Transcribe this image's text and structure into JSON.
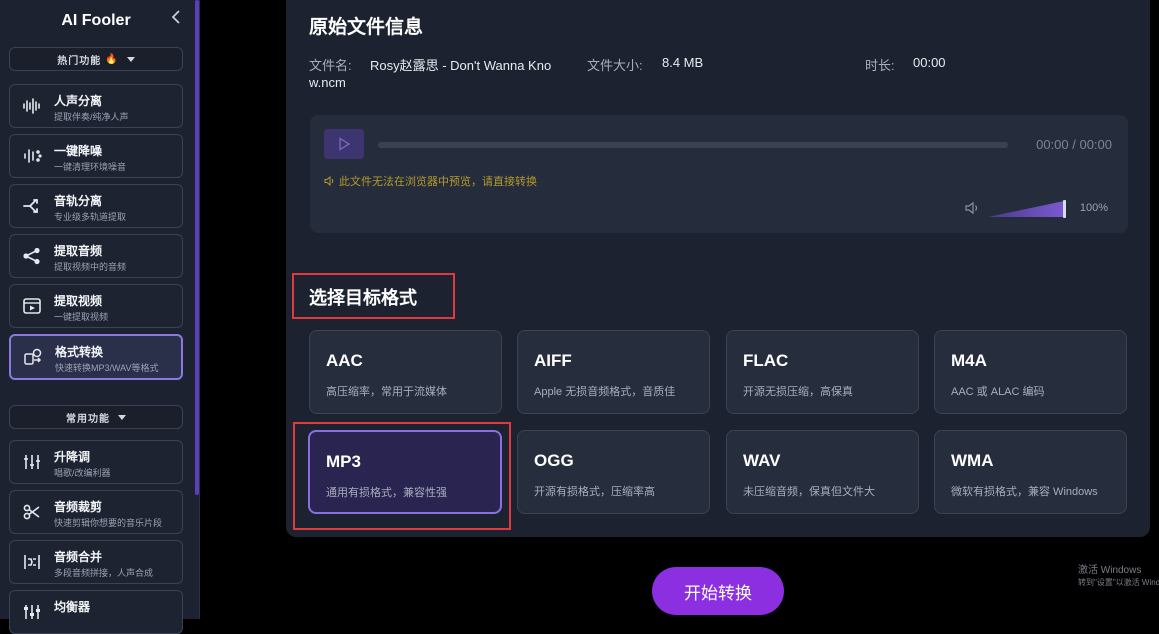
{
  "sidebar": {
    "brand": "AI Fooler",
    "hot_section": {
      "label": "热门功能",
      "icon": "fire-emoji"
    },
    "common_section": {
      "label": "常用功能"
    },
    "hot_items": [
      {
        "title": "人声分离",
        "sub": "提取伴奏/纯净人声",
        "icon": "waveform-icon"
      },
      {
        "title": "一键降噪",
        "sub": "一键清理环境噪音",
        "icon": "noise-reduce-icon"
      },
      {
        "title": "音轨分离",
        "sub": "专业级多轨道提取",
        "icon": "split-icon"
      },
      {
        "title": "提取音频",
        "sub": "提取视频中的音频",
        "icon": "share-icon"
      },
      {
        "title": "提取视频",
        "sub": "一键提取视频",
        "icon": "video-icon"
      },
      {
        "title": "格式转换",
        "sub": "快速转换MP3/WAV等格式",
        "icon": "convert-icon"
      }
    ],
    "common_items": [
      {
        "title": "升降调",
        "sub": "唱歌/改编利器",
        "icon": "pitch-icon"
      },
      {
        "title": "音频裁剪",
        "sub": "快速剪辑你想要的音乐片段",
        "icon": "scissors-icon"
      },
      {
        "title": "音频合并",
        "sub": "多段音频拼接，人声合成",
        "icon": "merge-icon"
      },
      {
        "title": "均衡器",
        "sub": "",
        "icon": "equalizer-icon"
      }
    ]
  },
  "file_info": {
    "heading": "原始文件信息",
    "name_label": "文件名:",
    "name_value_line1": "Rosy赵露思 - Don't Wanna Kno",
    "name_value_line2": "w.ncm",
    "size_label": "文件大小:",
    "size_value": "8.4 MB",
    "duration_label": "时长:",
    "duration_value": "00:00"
  },
  "player": {
    "time": "00:00 / 00:00",
    "warning": "此文件无法在浏览器中预览，请直接转换",
    "volume": "100%",
    "volume_level": 1.0
  },
  "formats": {
    "heading": "选择目标格式",
    "items": [
      {
        "name": "AAC",
        "desc": "高压缩率，常用于流媒体"
      },
      {
        "name": "AIFF",
        "desc": "Apple 无损音频格式，音质佳"
      },
      {
        "name": "FLAC",
        "desc": "开源无损压缩，高保真"
      },
      {
        "name": "M4A",
        "desc": "AAC 或 ALAC 编码"
      },
      {
        "name": "MP3",
        "desc": "通用有损格式，兼容性强"
      },
      {
        "name": "OGG",
        "desc": "开源有损格式，压缩率高"
      },
      {
        "name": "WAV",
        "desc": "未压缩音频，保真但文件大"
      },
      {
        "name": "WMA",
        "desc": "微软有损格式，兼容 Windows"
      }
    ],
    "selected": "MP3"
  },
  "start_button": "开始转换",
  "watermark": {
    "line1": "激活 Windows",
    "line2": "转到\"设置\"以激活 Windows"
  },
  "colors": {
    "accent": "#8b2fe0",
    "selected_border": "#8a6fe0",
    "highlight": "#e0393e",
    "warning": "#b59a2c"
  }
}
